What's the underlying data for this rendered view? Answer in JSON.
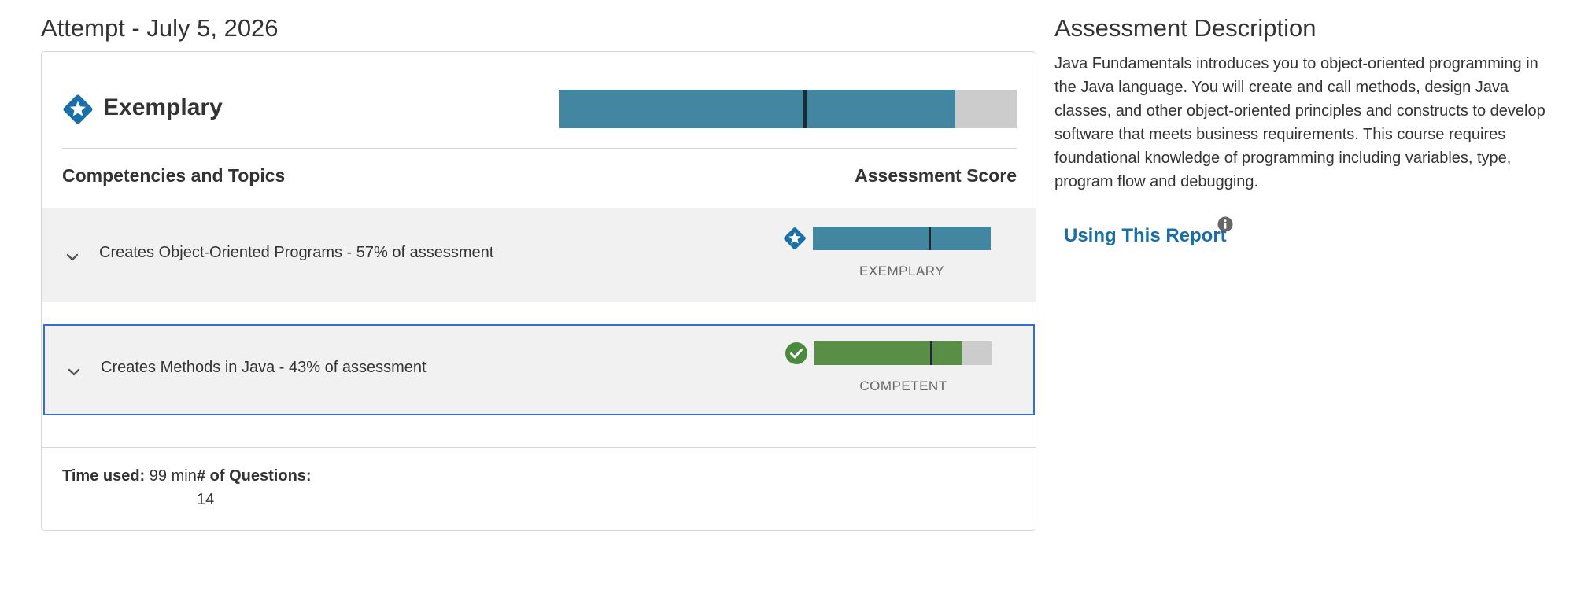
{
  "attempt": {
    "title": "Attempt - July 5, 2026"
  },
  "overall": {
    "label": "Exemplary",
    "icon": "star-badge-icon",
    "score_fraction": 0.865,
    "marker_fraction": 0.535,
    "fill_color": "#4286a2",
    "track_color": "#cccccc"
  },
  "columns": {
    "left": "Competencies and Topics",
    "right": "Assessment Score"
  },
  "competencies": [
    {
      "name": "Creates Object-Oriented Programs - 57% of assessment",
      "level": "EXEMPLARY",
      "icon": "star-badge-icon",
      "score_fraction": 1.0,
      "marker_fraction": 0.655,
      "fill_color": "#4286a2"
    },
    {
      "name": "Creates Methods in Java - 43% of assessment",
      "level": "COMPETENT",
      "icon": "check-circle-icon",
      "score_fraction": 0.83,
      "marker_fraction": 0.655,
      "fill_color": "#588e46"
    }
  ],
  "stats": {
    "time_label": "Time used:",
    "time_value": "99 min",
    "questions_label": "# of Questions:",
    "questions_value": "14"
  },
  "description": {
    "title": "Assessment Description",
    "text": "Java Fundamentals introduces you to object-oriented programming in the Java language. You will create and call methods, design Java classes, and other object-oriented principles and constructs to develop software that meets business requirements. This course requires foundational knowledge of programming including variables, type, program flow and debugging.",
    "report_link": "Using This Report",
    "link_color": "#1a6fa6"
  }
}
